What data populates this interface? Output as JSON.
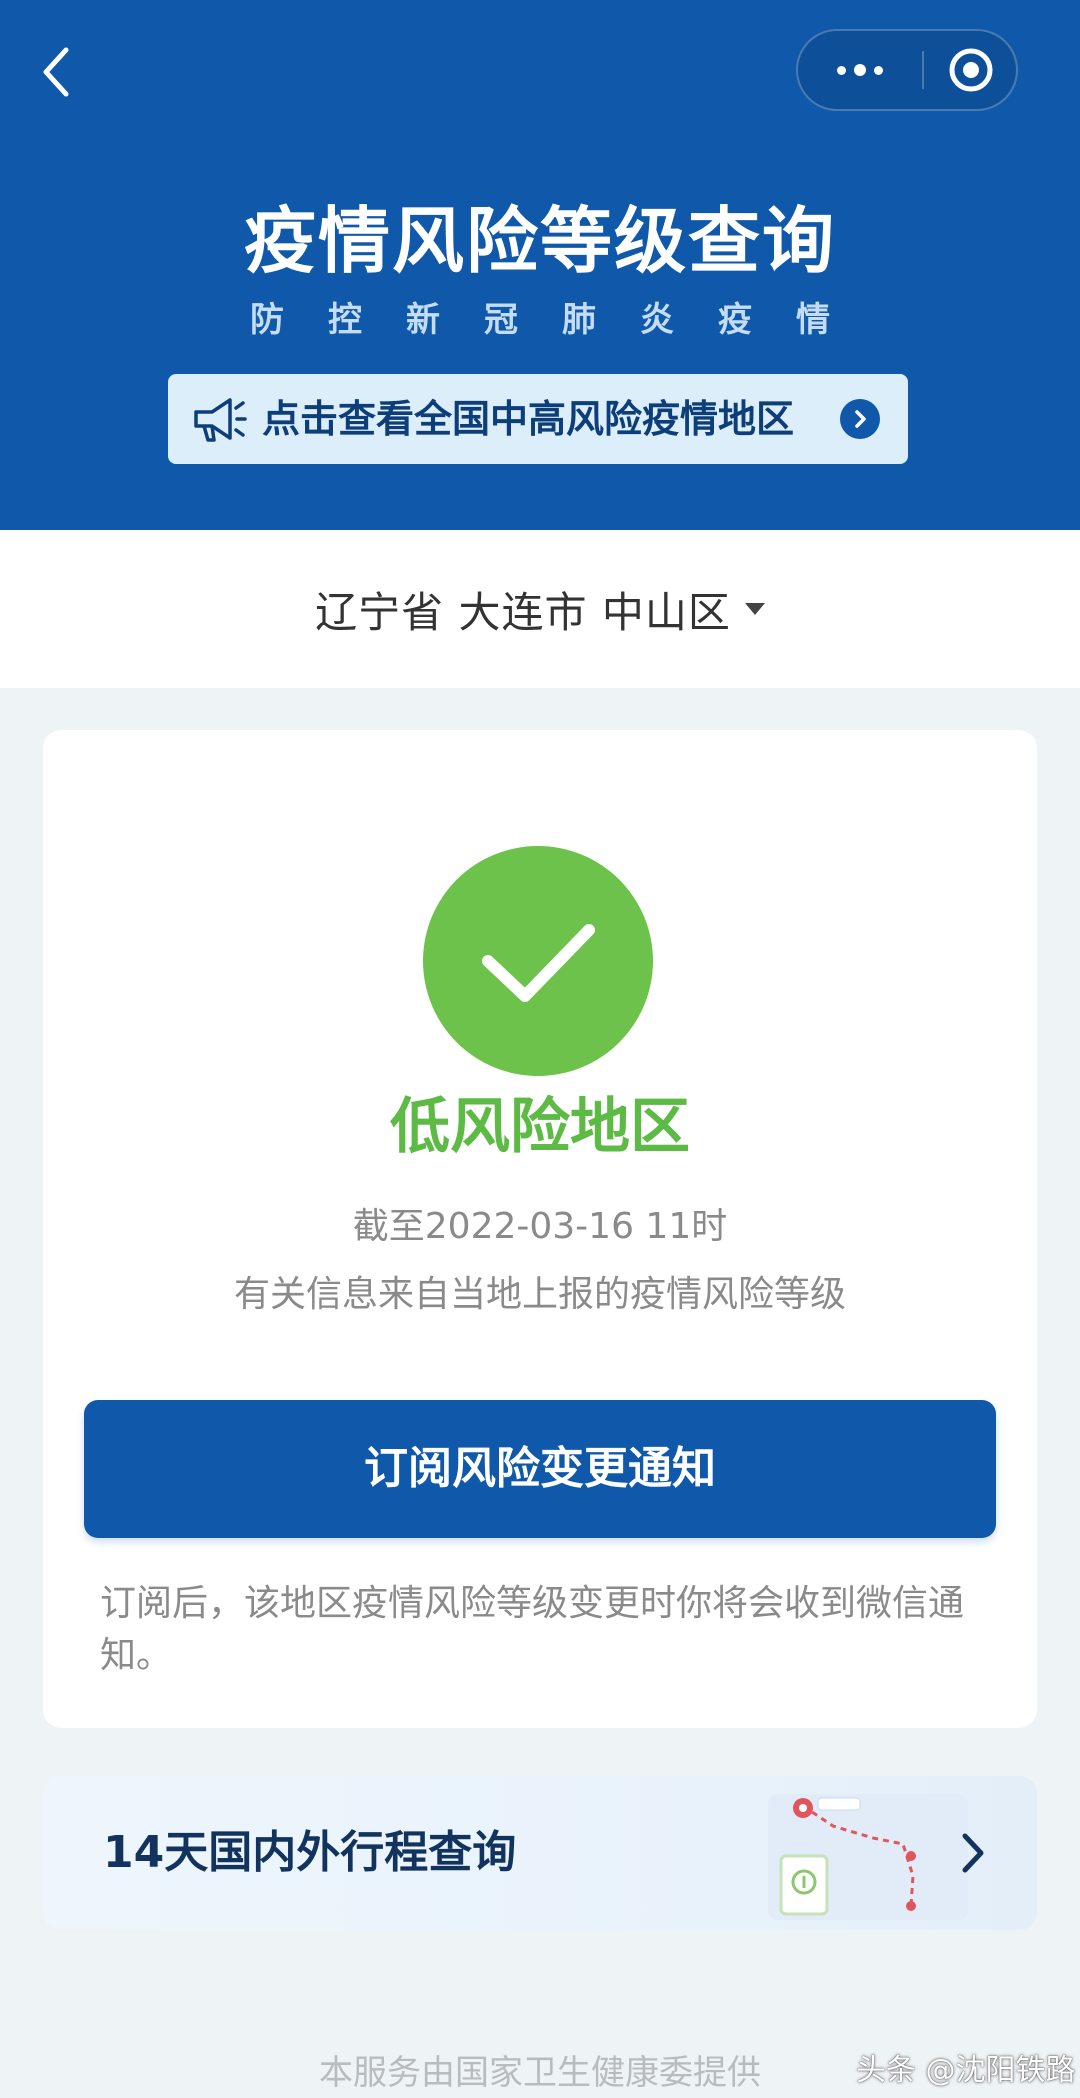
{
  "header": {
    "title": "疫情风险等级查询",
    "subtitle": "防控新冠肺炎疫情",
    "notice": "点击查看全国中高风险疫情地区",
    "bg_color": "#0f58aa"
  },
  "nav": {
    "back_icon": "chevron-left-icon",
    "more_icon": "more-dots-icon",
    "close_icon": "target-close-icon"
  },
  "location": {
    "text": "辽宁省 大连市 中山区",
    "dropdown_icon": "caret-down-icon"
  },
  "result": {
    "status_icon": "check-icon",
    "status": "低风险地区",
    "status_color": "#6cc24a",
    "as_of": "截至2022-03-16 11时",
    "source": "有关信息来自当地上报的疫情风险等级"
  },
  "subscribe": {
    "button_label": "订阅风险变更通知",
    "note": "订阅后，该地区疫情风险等级变更时你将会收到微信通知。"
  },
  "trip": {
    "label": "14天国内外行程查询",
    "chevron_icon": "chevron-right-icon",
    "illustration_icon": "map-route-icon"
  },
  "footer": {
    "text": "本服务由国家卫生健康委提供"
  },
  "watermark": {
    "text": "头条 @沈阳铁路"
  }
}
